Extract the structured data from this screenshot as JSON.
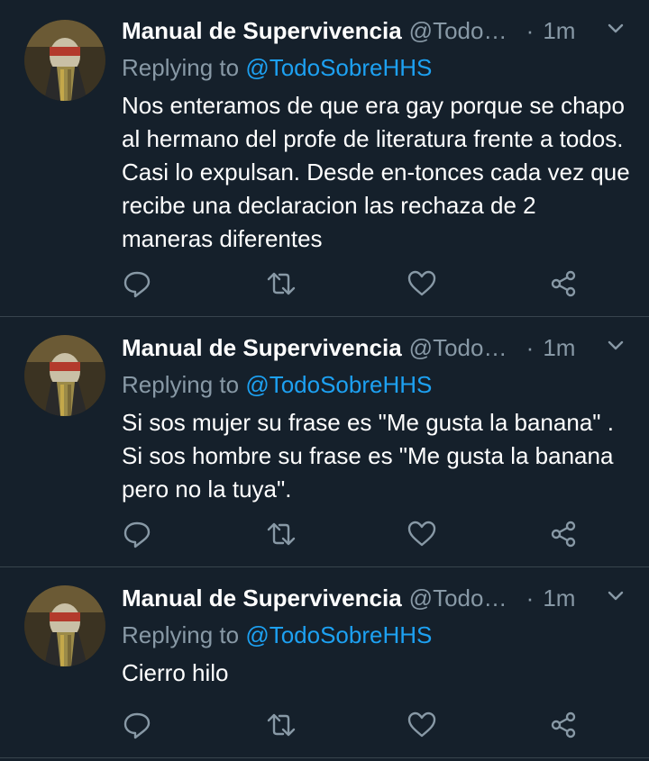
{
  "tweets": [
    {
      "author_name": "Manual de Supervivencia",
      "handle": "@TodoSobreHHS",
      "separator": "·",
      "time": "1m",
      "reply_prefix": "Replying to",
      "reply_to": "@TodoSobreHHS",
      "text": "Nos enteramos de que era gay porque se chapo al hermano del profe de literatura frente a todos. Casi lo expulsan. Desde en-tonces cada vez que recibe una declaracion las rechaza de 2 maneras diferentes"
    },
    {
      "author_name": "Manual de Supervivencia",
      "handle": "@TodoSobreHHS",
      "separator": "·",
      "time": "1m",
      "reply_prefix": "Replying to",
      "reply_to": "@TodoSobreHHS",
      "text": "Si sos mujer su frase es \"Me gusta la banana\" . Si sos hombre su frase es \"Me gusta la banana pero no la tuya\"."
    },
    {
      "author_name": "Manual de Supervivencia",
      "handle": "@TodoSobreHHS",
      "separator": "·",
      "time": "1m",
      "reply_prefix": "Replying to",
      "reply_to": "@TodoSobreHHS",
      "text": "Cierro hilo"
    }
  ],
  "icons": {
    "reply": "reply-icon",
    "retweet": "retweet-icon",
    "like": "heart-icon",
    "share": "share-icon",
    "menu": "chevron-down-icon"
  },
  "colors": {
    "background": "#15202b",
    "secondary_text": "#8899a6",
    "link": "#1da1f2",
    "divider": "#38444d"
  }
}
